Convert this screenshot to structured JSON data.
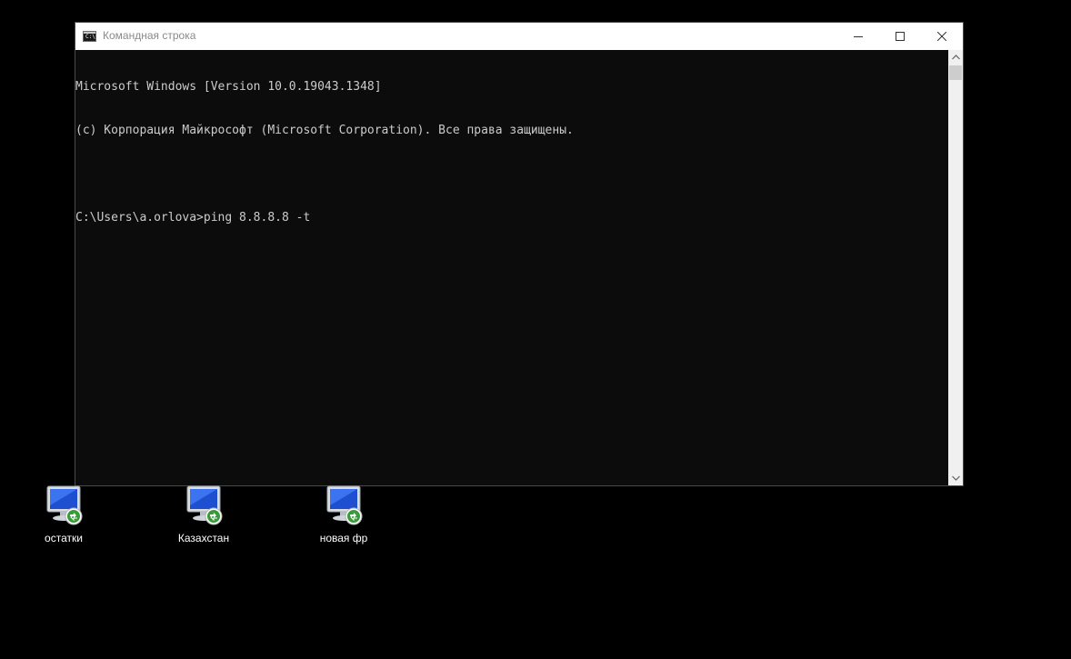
{
  "window": {
    "title": "Командная строка",
    "icon": "cmd-icon",
    "icon_text": "C:\\",
    "buttons": {
      "minimize": "minimize-icon",
      "maximize": "maximize-icon",
      "close": "close-icon"
    }
  },
  "console": {
    "lines": [
      "Microsoft Windows [Version 10.0.19043.1348]",
      "(c) Корпорация Майкрософт (Microsoft Corporation). Все права защищены.",
      "",
      "C:\\Users\\a.orlova>ping 8.8.8.8 -t"
    ],
    "text_color": "#cccccc",
    "background_color": "#0c0c0c"
  },
  "desktop": {
    "background_color": "#000000",
    "icons": [
      {
        "label": "остатки",
        "icon": "remote-desktop-icon"
      },
      {
        "label": "Казахстан",
        "icon": "remote-desktop-icon"
      },
      {
        "label": "новая фр",
        "icon": "remote-desktop-icon"
      }
    ]
  }
}
